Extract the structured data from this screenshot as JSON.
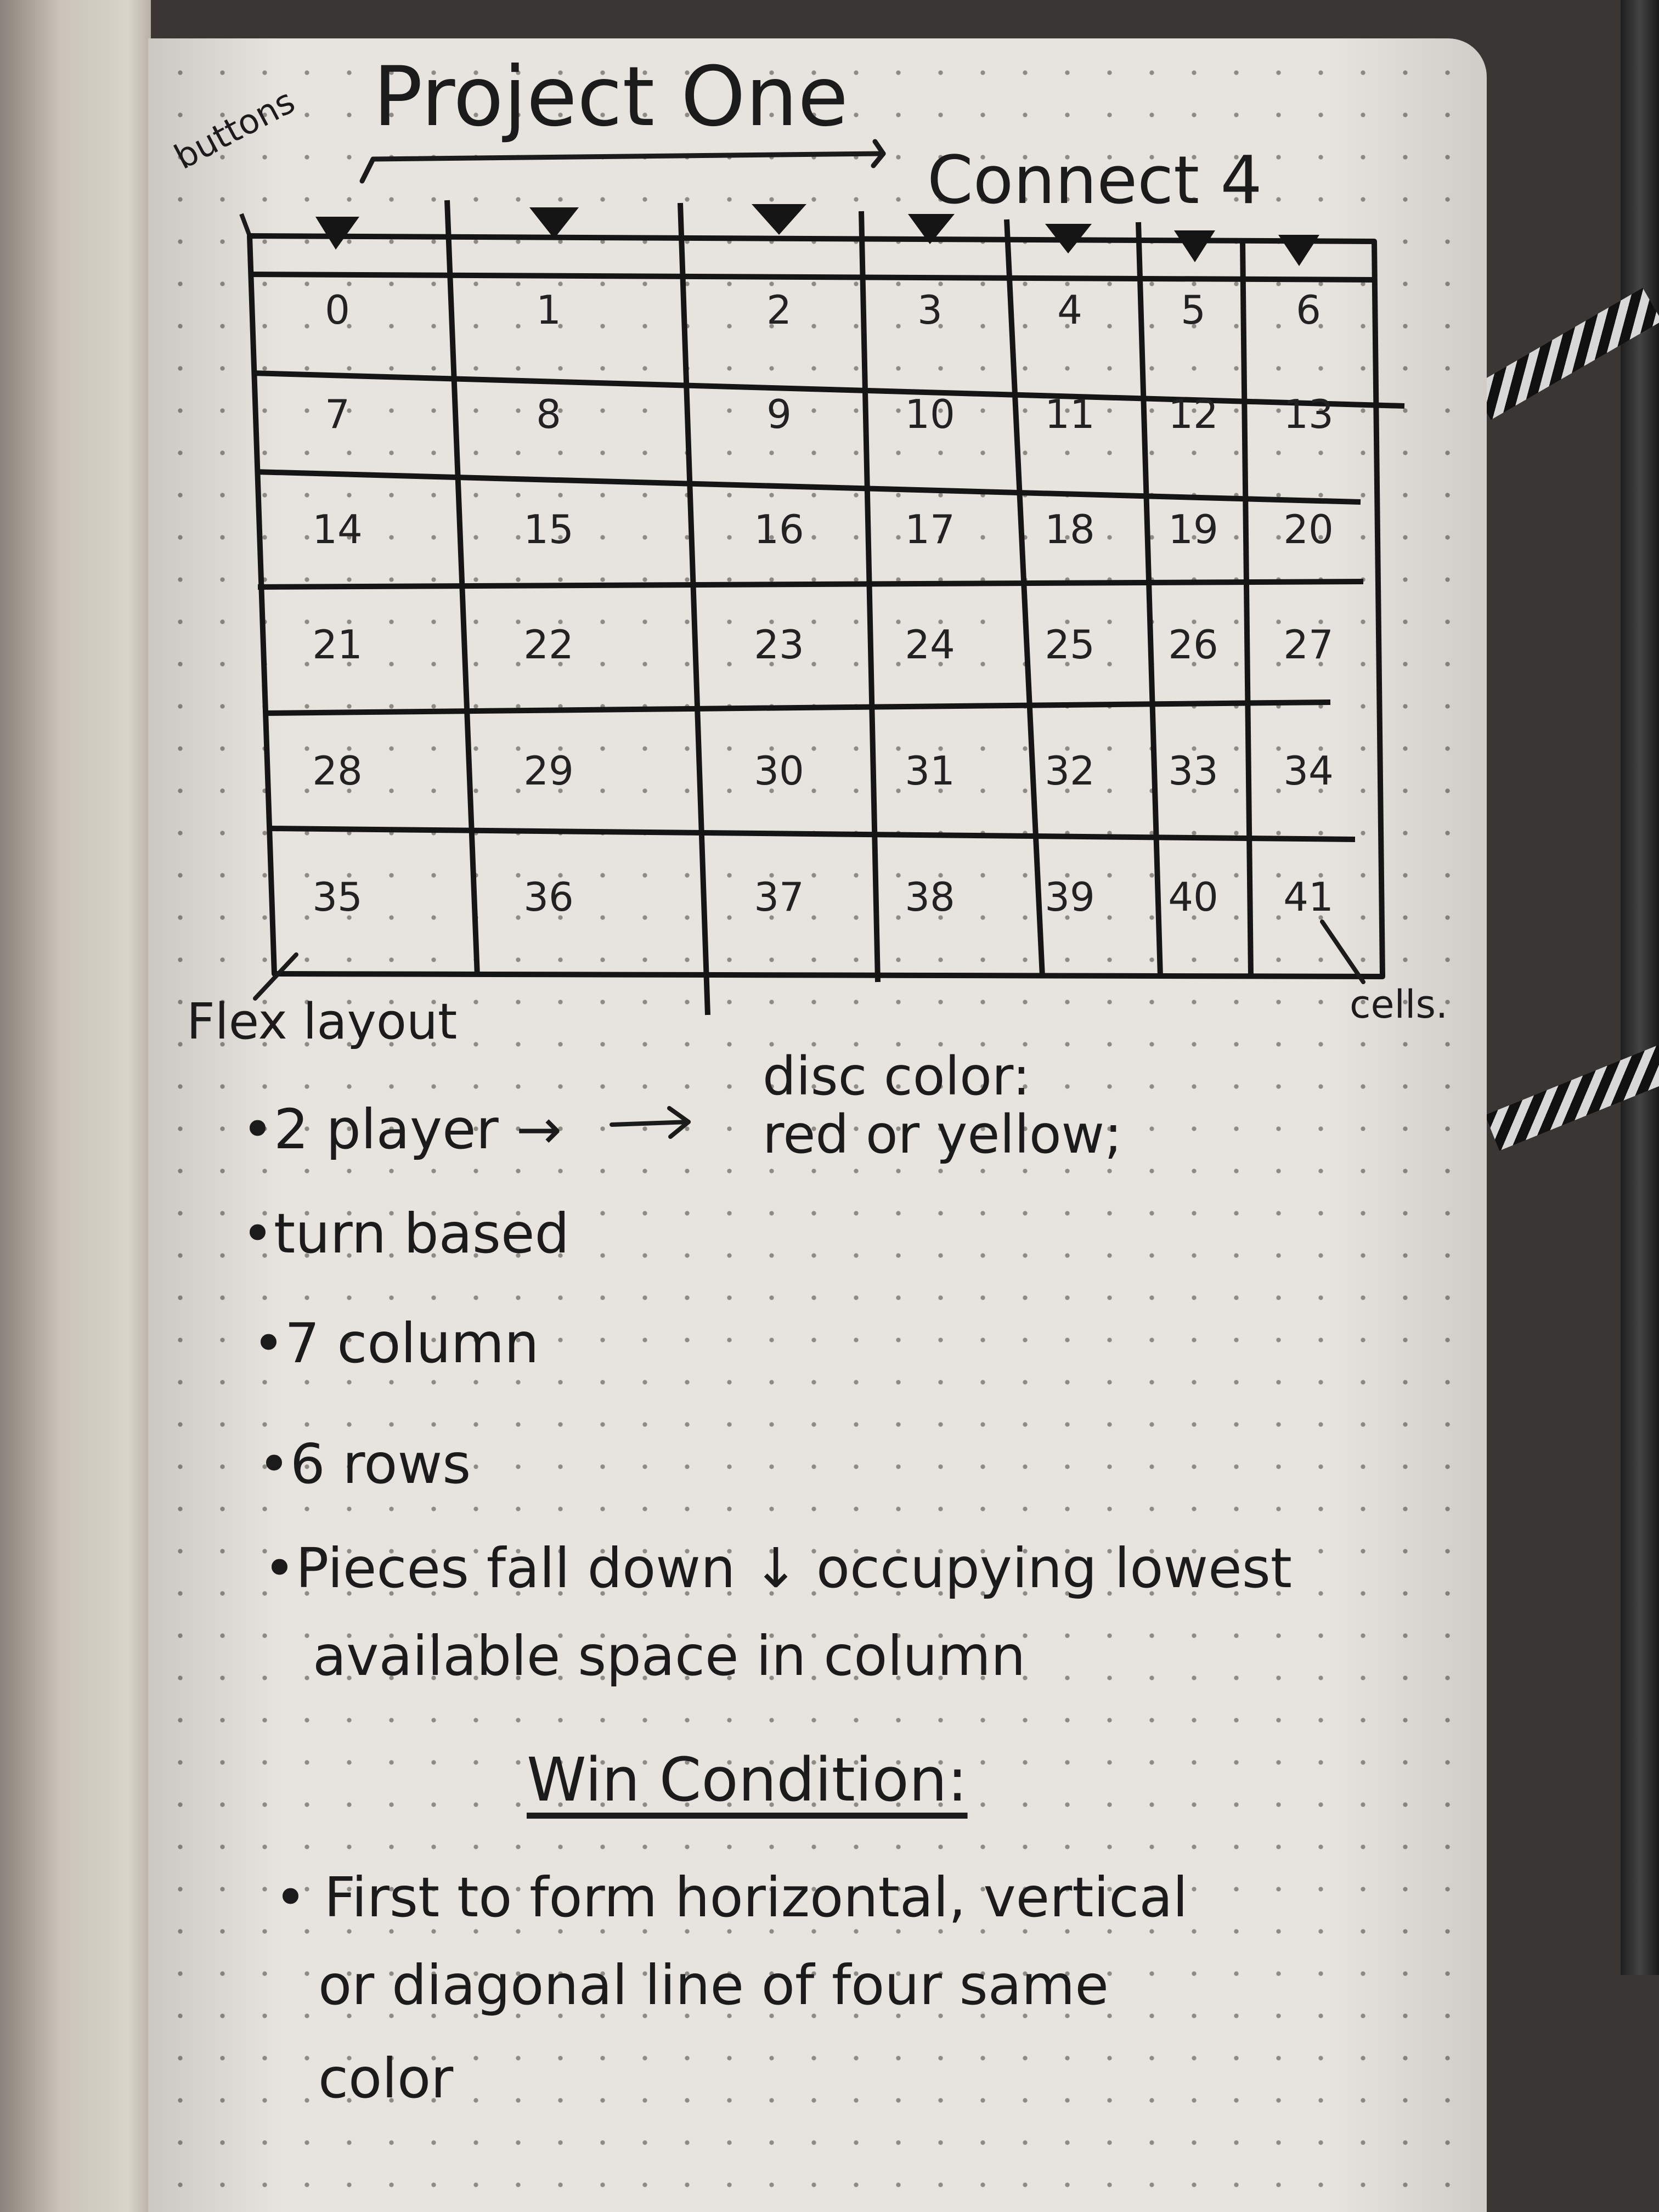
{
  "title": "Project One",
  "subtitle": "Connect 4",
  "annotations": {
    "buttons": "buttons",
    "flex": "Flex layout",
    "cells": "cells."
  },
  "board": {
    "columns": 7,
    "rows": 6,
    "cells": [
      "0",
      "1",
      "2",
      "3",
      "4",
      "5",
      "6",
      "7",
      "8",
      "9",
      "10",
      "11",
      "12",
      "13",
      "14",
      "15",
      "16",
      "17",
      "18",
      "19",
      "20",
      "21",
      "22",
      "23",
      "24",
      "25",
      "26",
      "27",
      "28",
      "29",
      "30",
      "31",
      "32",
      "33",
      "34",
      "35",
      "36",
      "37",
      "38",
      "39",
      "40",
      "41"
    ]
  },
  "disc_note": {
    "line1": "disc color:",
    "line2": "red or yellow;"
  },
  "notes": [
    "•2 player →",
    "•turn based",
    "•7 column",
    "•6 rows",
    "•Pieces fall down ↓ occupying lowest",
    "available space in column"
  ],
  "win": {
    "heading": "Win Condition:",
    "lines": [
      "• First to form horizontal, vertical",
      "or diagonal line of four same",
      "color"
    ]
  }
}
